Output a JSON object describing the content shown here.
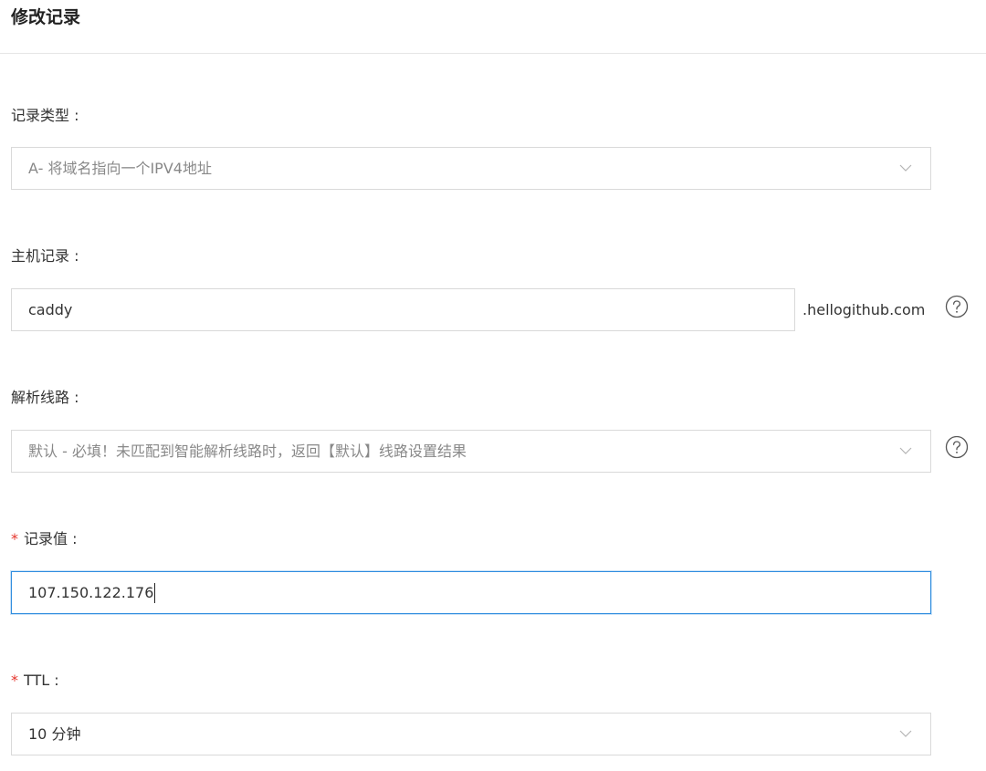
{
  "header": {
    "title": "修改记录"
  },
  "form": {
    "record_type": {
      "label": "记录类型 :",
      "value": "A- 将域名指向一个IPV4地址",
      "chevron_icon": "chevron-down-icon"
    },
    "host": {
      "label": "主机记录 :",
      "value": "caddy",
      "suffix": ".hellogithub.com",
      "help_icon": "question-circle-icon"
    },
    "line": {
      "label": "解析线路 :",
      "value": "默认 - 必填！未匹配到智能解析线路时，返回【默认】线路设置结果",
      "help_icon": "question-circle-icon"
    },
    "record_value": {
      "required_mark": "*",
      "label": "记录值 :",
      "value": "107.150.122.176"
    },
    "ttl": {
      "required_mark": "*",
      "label": "TTL :",
      "value": "10 分钟"
    }
  },
  "colors": {
    "required": "#e5352d",
    "focus_border": "#2f8ddf",
    "border": "#d9d9d9"
  }
}
